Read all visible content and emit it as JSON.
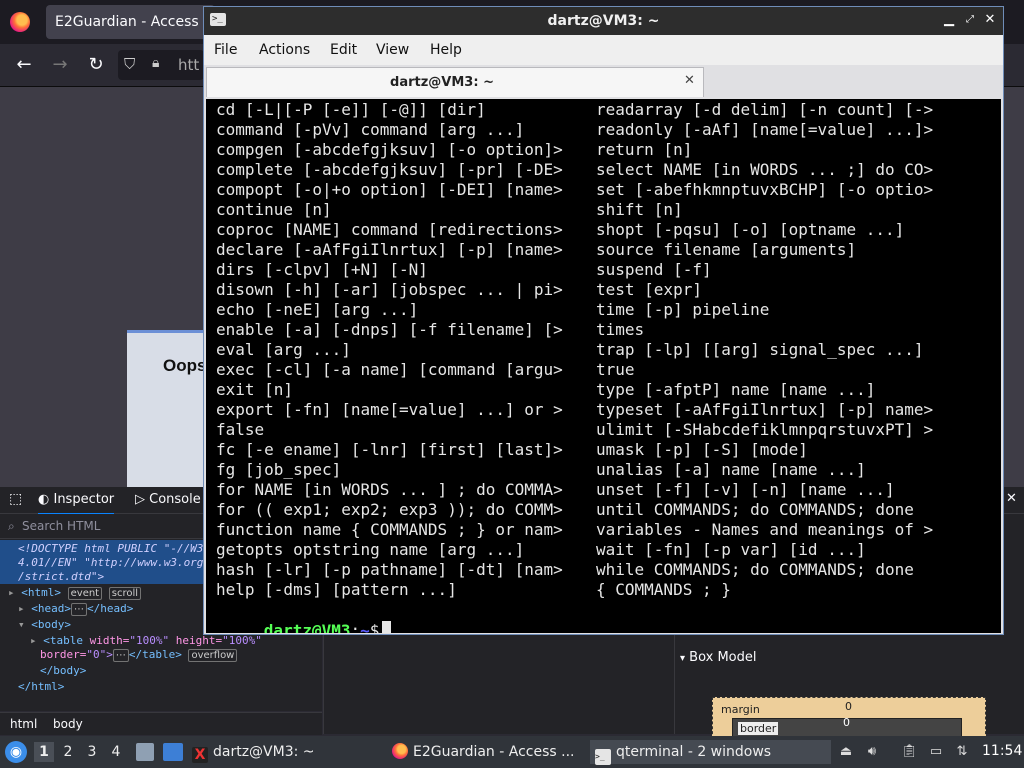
{
  "firefox": {
    "tab_title": "E2Guardian - Access D",
    "url_partial": "htt",
    "page_heading_partial": "Oops"
  },
  "devtools": {
    "tabs": [
      "Inspector",
      "Console"
    ],
    "search_placeholder": "Search HTML",
    "tree": {
      "doctype_1": "<!DOCTYPE html PUBLIC \"-//W3",
      "doctype_2": "4.01//EN\" \"http://www.w3.org",
      "doctype_3": "/strict.dtd\">",
      "html_open": "<html>",
      "badge_event": "event",
      "badge_scroll": "scroll",
      "head": "<head>",
      "head_close": "</head>",
      "body_open": "<body>",
      "table_tag": "<table",
      "table_attr_width": "width=",
      "table_val_width": "\"100%\"",
      "table_attr_height": "height=",
      "table_val_height": "\"100%\"",
      "table_attr_border": "border=",
      "table_val_border": "\"0\">",
      "table_close": "</table>",
      "badge_overflow": "overflow",
      "body_close": "</body>",
      "html_close": "</html>",
      "ellipsis": "⋯"
    },
    "breadcrumbs": [
      "html",
      "body"
    ],
    "box_model": {
      "header": "Box Model",
      "margin_label": "margin",
      "margin_value": "0",
      "border_label": "border",
      "border_value": "0"
    }
  },
  "terminal": {
    "window_title": "dartz@VM3: ~",
    "tab_title": "dartz@VM3: ~",
    "menu": [
      "File",
      "Actions",
      "Edit",
      "View",
      "Help"
    ],
    "left_column": [
      "cd [-L|[-P [-e]] [-@]] [dir]",
      "command [-pVv] command [arg ...]",
      "compgen [-abcdefgjksuv] [-o option]>",
      "complete [-abcdefgjksuv] [-pr] [-DE>",
      "compopt [-o|+o option] [-DEI] [name>",
      "continue [n]",
      "coproc [NAME] command [redirections>",
      "declare [-aAfFgiIlnrtux] [-p] [name>",
      "dirs [-clpv] [+N] [-N]",
      "disown [-h] [-ar] [jobspec ... | pi>",
      "echo [-neE] [arg ...]",
      "enable [-a] [-dnps] [-f filename] [>",
      "eval [arg ...]",
      "exec [-cl] [-a name] [command [argu>",
      "exit [n]",
      "export [-fn] [name[=value] ...] or >",
      "false",
      "fc [-e ename] [-lnr] [first] [last]>",
      "fg [job_spec]",
      "for NAME [in WORDS ... ] ; do COMMA>",
      "for (( exp1; exp2; exp3 )); do COMM>",
      "function name { COMMANDS ; } or nam>",
      "getopts optstring name [arg ...]",
      "hash [-lr] [-p pathname] [-dt] [nam>",
      "help [-dms] [pattern ...]"
    ],
    "right_column": [
      "readarray [-d delim] [-n count] [->",
      "readonly [-aAf] [name[=value] ...]>",
      "return [n]",
      "select NAME [in WORDS ... ;] do CO>",
      "set [-abefhkmnptuvxBCHP] [-o optio>",
      "shift [n]",
      "shopt [-pqsu] [-o] [optname ...]",
      "source filename [arguments]",
      "suspend [-f]",
      "test [expr]",
      "time [-p] pipeline",
      "times",
      "trap [-lp] [[arg] signal_spec ...]",
      "true",
      "type [-afptP] name [name ...]",
      "typeset [-aAfFgiIlnrtux] [-p] name>",
      "ulimit [-SHabcdefiklmnpqrstuvxPT] >",
      "umask [-p] [-S] [mode]",
      "unalias [-a] name [name ...]",
      "unset [-f] [-v] [-n] [name ...]",
      "until COMMANDS; do COMMANDS; done",
      "variables - Names and meanings of >",
      "wait [-fn] [-p var] [id ...]",
      "while COMMANDS; do COMMANDS; done",
      "{ COMMANDS ; }"
    ],
    "prompt_user": "dartz@VM3",
    "prompt_colon": ":",
    "prompt_path": "~",
    "prompt_symbol": "$"
  },
  "taskbar": {
    "workspaces": [
      "1",
      "2",
      "3",
      "4"
    ],
    "apps": [
      {
        "label": "dartz@VM3: ~",
        "icon": "xterm-icon"
      },
      {
        "label": "E2Guardian - Access ...",
        "icon": "firefox-icon"
      },
      {
        "label": "qterminal - 2 windows",
        "icon": "terminal-icon"
      }
    ],
    "clock": "11:54"
  },
  "colors": {
    "prompt_user": "#55ff55",
    "prompt_path": "#5c5cff",
    "terminal_bg": "#000000",
    "accent": "#0a84ff"
  }
}
